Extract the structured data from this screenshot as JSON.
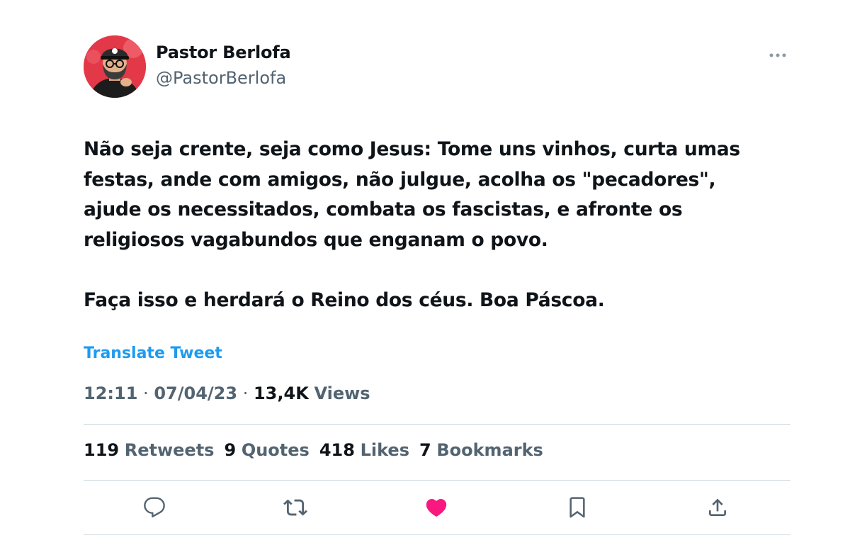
{
  "author": {
    "display_name": "Pastor Berlofa",
    "handle": "@PastorBerlofa",
    "avatar_icon": "avatar-photo"
  },
  "tweet": {
    "text": "Não seja crente, seja como Jesus: Tome uns vinhos, curta umas\nfestas, ande com amigos, não julgue, acolha os \"pecadores\",\najude os necessitados, combata os fascistas, e afronte os\nreligiosos vagabundos que enganam o povo.\n\nFaça isso e herdará o Reino dos céus. Boa Páscoa.",
    "translate_label": "Translate Tweet",
    "time": "12:11",
    "separator": "·",
    "date": "07/04/23",
    "views_count": "13,4K",
    "views_label": "Views"
  },
  "stats": [
    {
      "num": "119",
      "label": "Retweets"
    },
    {
      "num": "9",
      "label": "Quotes"
    },
    {
      "num": "418",
      "label": "Likes"
    },
    {
      "num": "7",
      "label": "Bookmarks"
    }
  ],
  "actions": {
    "reply_icon": "reply-icon",
    "retweet_icon": "retweet-icon",
    "like_icon": "heart-icon",
    "bookmark_icon": "bookmark-icon",
    "share_icon": "share-icon",
    "more_icon": "more-dots-icon"
  },
  "colors": {
    "accent": "#1d9bf0",
    "like": "#f91880",
    "secondary_text": "#536471",
    "divider": "#cfd9de"
  }
}
